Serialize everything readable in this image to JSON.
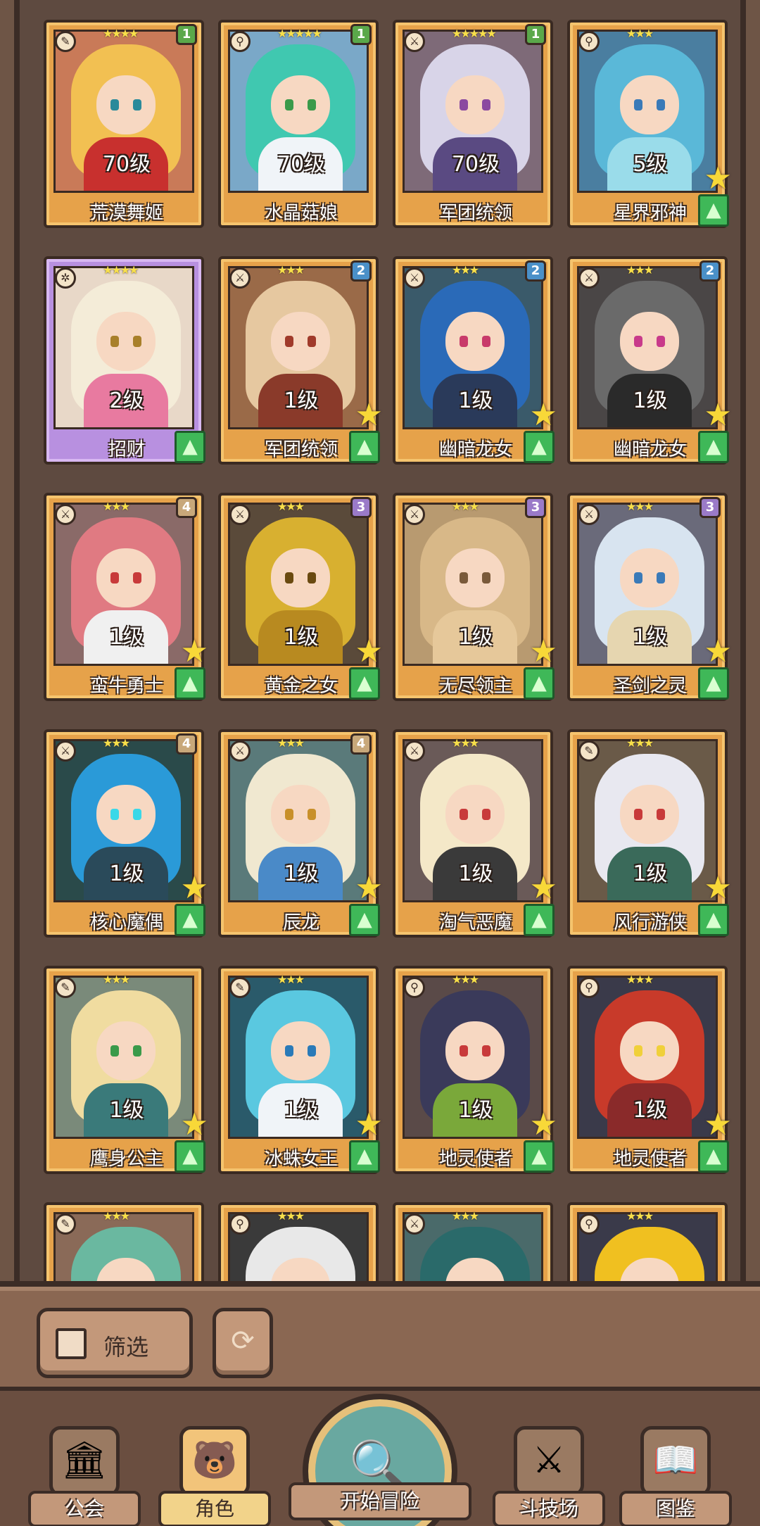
{
  "heroes": [
    {
      "name": "荒漠舞姬",
      "level": "70级",
      "stars": "★★★★",
      "badge": "1",
      "badge_color": "#5aa84a",
      "element_icon": "leaf-icon",
      "hair": "#f2c052",
      "outfit": "#c8302e",
      "eye": "#2a8a9a",
      "bg": "#c97a58",
      "frame": "gold",
      "star_up": false,
      "arrow_up": false
    },
    {
      "name": "水晶菇娘",
      "level": "70级",
      "stars": "★★★★★",
      "badge": "1",
      "badge_color": "#5aa84a",
      "element_icon": "wand-icon",
      "hair": "#40c8b0",
      "outfit": "#f0f4f8",
      "eye": "#3a9a4a",
      "bg": "#7aa8c8",
      "frame": "gold",
      "star_up": false,
      "arrow_up": false
    },
    {
      "name": "军团统领",
      "level": "70级",
      "stars": "★★★★★",
      "badge": "1",
      "badge_color": "#5aa84a",
      "element_icon": "sword-icon",
      "hair": "#d8d4e8",
      "outfit": "#5a4a82",
      "eye": "#8a4aa0",
      "bg": "#7e6a78",
      "frame": "gold",
      "star_up": false,
      "arrow_up": false
    },
    {
      "name": "星界邪神",
      "level": "5级",
      "stars": "★★★",
      "badge": "",
      "badge_color": "",
      "element_icon": "wand-icon",
      "hair": "#5ab8d8",
      "outfit": "#9adcea",
      "eye": "#3a7ab8",
      "bg": "#4a7ea0",
      "frame": "gold",
      "star_up": true,
      "arrow_up": true
    },
    {
      "name": "招财",
      "level": "2级",
      "stars": "★★★★",
      "badge": "",
      "badge_color": "",
      "element_icon": "gear-icon",
      "hair": "#f4ecd8",
      "outfit": "#e87aa0",
      "eye": "#a8802a",
      "bg": "#e8d8c8",
      "frame": "purple",
      "star_up": false,
      "arrow_up": true
    },
    {
      "name": "军团统领",
      "level": "1级",
      "stars": "★★★",
      "badge": "2",
      "badge_color": "#4a90c8",
      "element_icon": "sword-icon",
      "hair": "#e6c8a0",
      "outfit": "#8a3a2a",
      "eye": "#a03a2a",
      "bg": "#9a6a48",
      "frame": "gold",
      "star_up": true,
      "arrow_up": true
    },
    {
      "name": "幽暗龙女",
      "level": "1级",
      "stars": "★★★",
      "badge": "2",
      "badge_color": "#4a90c8",
      "element_icon": "sword-icon",
      "hair": "#2a6ab8",
      "outfit": "#2a3a5a",
      "eye": "#c83a6a",
      "bg": "#3a5a6a",
      "frame": "gold",
      "star_up": true,
      "arrow_up": true
    },
    {
      "name": "幽暗龙女",
      "level": "1级",
      "stars": "★★★",
      "badge": "2",
      "badge_color": "#4a90c8",
      "element_icon": "sword-icon",
      "hair": "#6a6a6a",
      "outfit": "#2a2a2a",
      "eye": "#c83a8a",
      "bg": "#4a4646",
      "frame": "gold",
      "star_up": true,
      "arrow_up": true
    },
    {
      "name": "蛮牛勇士",
      "level": "1级",
      "stars": "★★★",
      "badge": "4",
      "badge_color": "#c8a87a",
      "element_icon": "sword-icon",
      "hair": "#e07a82",
      "outfit": "#f0f0f0",
      "eye": "#c83a3a",
      "bg": "#8a6a68",
      "frame": "gold",
      "star_up": true,
      "arrow_up": true
    },
    {
      "name": "黄金之女",
      "level": "1级",
      "stars": "★★★",
      "badge": "3",
      "badge_color": "#9a7ac8",
      "element_icon": "sword-icon",
      "hair": "#d8b030",
      "outfit": "#b88a20",
      "eye": "#6a4a10",
      "bg": "#5a4a3a",
      "frame": "gold",
      "star_up": true,
      "arrow_up": true
    },
    {
      "name": "无尽领主",
      "level": "1级",
      "stars": "★★★",
      "badge": "3",
      "badge_color": "#9a7ac8",
      "element_icon": "sword-icon",
      "hair": "#d8b888",
      "outfit": "#e6c89a",
      "eye": "#7a5a3a",
      "bg": "#b89a70",
      "frame": "gold",
      "star_up": true,
      "arrow_up": true
    },
    {
      "name": "圣剑之灵",
      "level": "1级",
      "stars": "★★★",
      "badge": "3",
      "badge_color": "#9a7ac8",
      "element_icon": "sword-icon",
      "hair": "#d8e4f0",
      "outfit": "#e6d6b0",
      "eye": "#3a7ab8",
      "bg": "#6a6a7a",
      "frame": "gold",
      "star_up": true,
      "arrow_up": true
    },
    {
      "name": "核心魔偶",
      "level": "1级",
      "stars": "★★★",
      "badge": "4",
      "badge_color": "#c8a87a",
      "element_icon": "sword-icon",
      "hair": "#2a9ad8",
      "outfit": "#2a4a5a",
      "eye": "#3ad8e8",
      "bg": "#2a4a4a",
      "frame": "gold",
      "star_up": true,
      "arrow_up": true
    },
    {
      "name": "辰龙",
      "level": "1级",
      "stars": "★★★",
      "badge": "4",
      "badge_color": "#c8a87a",
      "element_icon": "sword-icon",
      "hair": "#f0e8d0",
      "outfit": "#4a8ac8",
      "eye": "#c8902a",
      "bg": "#5a7a7a",
      "frame": "gold",
      "star_up": true,
      "arrow_up": true
    },
    {
      "name": "淘气恶魔",
      "level": "1级",
      "stars": "★★★",
      "badge": "",
      "badge_color": "",
      "element_icon": "sword-icon",
      "hair": "#f4e8c8",
      "outfit": "#3a3a3a",
      "eye": "#c83a3a",
      "bg": "#6a5a58",
      "frame": "gold",
      "star_up": true,
      "arrow_up": true
    },
    {
      "name": "风行游侠",
      "level": "1级",
      "stars": "★★★",
      "badge": "",
      "badge_color": "",
      "element_icon": "leaf-icon",
      "hair": "#e8e8f0",
      "outfit": "#3a6a5a",
      "eye": "#c83a3a",
      "bg": "#6a5a48",
      "frame": "gold",
      "star_up": true,
      "arrow_up": true
    },
    {
      "name": "鹰身公主",
      "level": "1级",
      "stars": "★★★",
      "badge": "",
      "badge_color": "",
      "element_icon": "leaf-icon",
      "hair": "#f0dca0",
      "outfit": "#3a7a7a",
      "eye": "#3a9a4a",
      "bg": "#7a8a7a",
      "frame": "gold",
      "star_up": true,
      "arrow_up": true
    },
    {
      "name": "冰蛛女王",
      "level": "1级",
      "stars": "★★★",
      "badge": "",
      "badge_color": "",
      "element_icon": "leaf-icon",
      "hair": "#5ac8e0",
      "outfit": "#f0f4f8",
      "eye": "#2a7ab8",
      "bg": "#2a5a6a",
      "frame": "gold",
      "star_up": true,
      "arrow_up": true
    },
    {
      "name": "地灵使者",
      "level": "1级",
      "stars": "★★★",
      "badge": "",
      "badge_color": "",
      "element_icon": "wand-icon",
      "hair": "#3a3a5a",
      "outfit": "#7aa83a",
      "eye": "#c83a3a",
      "bg": "#5a4a48",
      "frame": "gold",
      "star_up": true,
      "arrow_up": true
    },
    {
      "name": "地灵使者",
      "level": "1级",
      "stars": "★★★",
      "badge": "",
      "badge_color": "",
      "element_icon": "wand-icon",
      "hair": "#c83a2a",
      "outfit": "#8a2a2a",
      "eye": "#f0d03a",
      "bg": "#3a3a4a",
      "frame": "gold",
      "star_up": true,
      "arrow_up": true
    },
    {
      "name": "",
      "level": "",
      "stars": "★★★",
      "badge": "",
      "badge_color": "",
      "element_icon": "leaf-icon",
      "hair": "#6ab8a0",
      "outfit": "#e8e0d8",
      "eye": "#c83a3a",
      "bg": "#8a6a58",
      "frame": "gold",
      "star_up": false,
      "arrow_up": false
    },
    {
      "name": "",
      "level": "",
      "stars": "★★★",
      "badge": "",
      "badge_color": "",
      "element_icon": "wand-icon",
      "hair": "#e8e8e8",
      "outfit": "#2a2a2a",
      "eye": "#3a9a4a",
      "bg": "#3a3a3a",
      "frame": "gold",
      "star_up": false,
      "arrow_up": false
    },
    {
      "name": "",
      "level": "",
      "stars": "★★★",
      "badge": "",
      "badge_color": "",
      "element_icon": "sword-icon",
      "hair": "#2a6a6a",
      "outfit": "#4a9a8a",
      "eye": "#3a9a4a",
      "bg": "#4a6a6a",
      "frame": "gold",
      "star_up": false,
      "arrow_up": false
    },
    {
      "name": "",
      "level": "",
      "stars": "★★★",
      "badge": "",
      "badge_color": "",
      "element_icon": "wand-icon",
      "hair": "#f0c020",
      "outfit": "#e0a010",
      "eye": "#6a4a10",
      "bg": "#3a3a4a",
      "frame": "gold",
      "star_up": false,
      "arrow_up": false
    }
  ],
  "filter": {
    "label": "筛选",
    "icon": "grid-icon"
  },
  "reset": {
    "icon": "refresh-icon"
  },
  "nav": {
    "guild": "公会",
    "hero": "角色",
    "adventure": "开始冒险",
    "arena": "斗技场",
    "codex": "图鉴"
  }
}
